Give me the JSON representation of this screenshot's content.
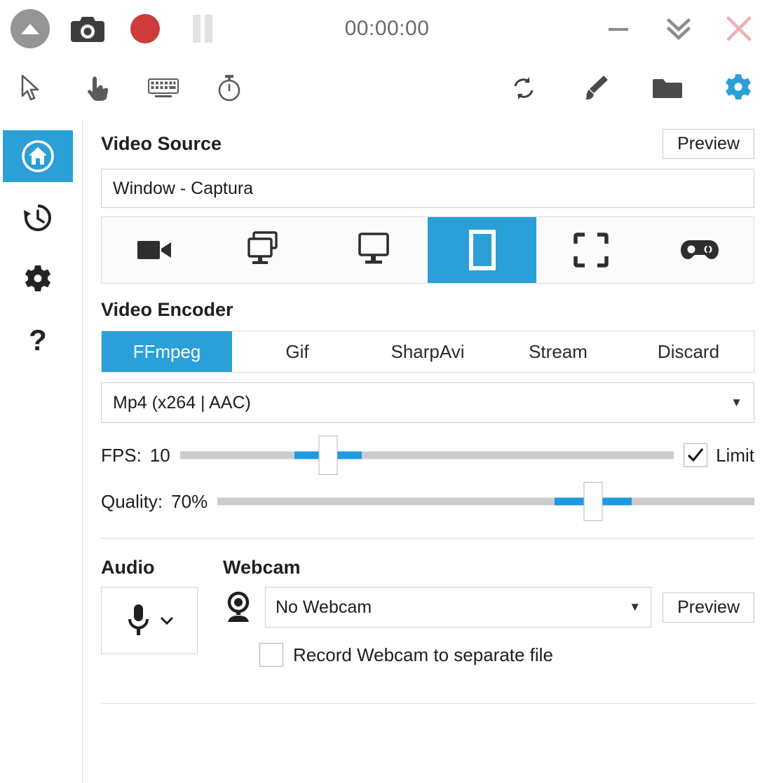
{
  "titlebar": {
    "collapse_icon": "circle-up-arrow-icon",
    "screenshot_icon": "camera-icon",
    "record_icon": "record-circle-icon",
    "pause_icon": "pause-icon",
    "timer": "00:00:00",
    "minimize_icon": "minimize-icon",
    "hide_icon": "double-chevron-down-icon",
    "close_icon": "close-x-icon",
    "record_color": "#CE3B3B",
    "close_color": "#F0B0B0"
  },
  "toolbar": {
    "left_icons": [
      {
        "name": "cursor-icon"
      },
      {
        "name": "click-hand-icon"
      },
      {
        "name": "keyboard-icon"
      },
      {
        "name": "stopwatch-icon"
      }
    ],
    "right_icons": [
      {
        "name": "refresh-icon"
      },
      {
        "name": "paintbrush-icon"
      },
      {
        "name": "folder-icon"
      },
      {
        "name": "gear-icon"
      }
    ],
    "gear_color": "#2A9FD8"
  },
  "sidebar": {
    "items": [
      {
        "name": "sidebar-item-home",
        "icon": "home-icon",
        "active": true
      },
      {
        "name": "sidebar-item-history",
        "icon": "history-icon",
        "active": false
      },
      {
        "name": "sidebar-item-settings",
        "icon": "gear-icon",
        "active": false
      },
      {
        "name": "sidebar-item-help",
        "icon": "question-mark-icon",
        "active": false
      }
    ],
    "active_color": "#2A9FD8"
  },
  "video_source": {
    "title": "Video Source",
    "preview_label": "Preview",
    "value": "Window  -  Captura",
    "buttons": [
      {
        "name": "source-video-camera",
        "icon": "video-camera-icon",
        "active": false
      },
      {
        "name": "source-multi-screen",
        "icon": "multi-screen-icon",
        "active": false
      },
      {
        "name": "source-screen",
        "icon": "screen-icon",
        "active": false
      },
      {
        "name": "source-window",
        "icon": "window-icon",
        "active": true
      },
      {
        "name": "source-region",
        "icon": "region-crop-icon",
        "active": false
      },
      {
        "name": "source-game",
        "icon": "gamepad-icon",
        "active": false
      }
    ]
  },
  "video_encoder": {
    "title": "Video Encoder",
    "tabs": [
      {
        "label": "FFmpeg",
        "active": true
      },
      {
        "label": "Gif",
        "active": false
      },
      {
        "label": "SharpAvi",
        "active": false
      },
      {
        "label": "Stream",
        "active": false
      },
      {
        "label": "Discard",
        "active": false
      }
    ],
    "codec": "Mp4 (x264 | AAC)",
    "codec_arrow": "chevron-down-icon",
    "fps": {
      "label": "FPS:",
      "value": "10",
      "percent": 30,
      "limit_label": "Limit",
      "limit_checked": true,
      "check_glyph": "check-icon"
    },
    "quality": {
      "label": "Quality:",
      "value": "70%",
      "percent": 70
    },
    "accent": "#1E9BE0"
  },
  "audio": {
    "title": "Audio",
    "mic_icon": "microphone-icon",
    "dropdown_icon": "chevron-down-icon"
  },
  "webcam": {
    "title": "Webcam",
    "icon": "webcam-icon",
    "value": "No Webcam",
    "arrow": "chevron-down-icon",
    "preview_label": "Preview",
    "separate_file_label": "Record Webcam to separate file",
    "separate_file_checked": false
  }
}
